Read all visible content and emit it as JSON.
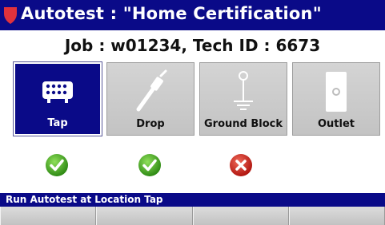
{
  "header": {
    "title": "Autotest : \"Home Certification\"",
    "job_line": "Job : w01234, Tech ID : 6673"
  },
  "locations": [
    {
      "label": "Tap",
      "icon": "tap-icon",
      "selected": true,
      "result": "pass"
    },
    {
      "label": "Drop",
      "icon": "drop-cable-icon",
      "selected": false,
      "result": "pass"
    },
    {
      "label": "Ground Block",
      "icon": "ground-block-icon",
      "selected": false,
      "result": "fail"
    },
    {
      "label": "Outlet",
      "icon": "outlet-icon",
      "selected": false,
      "result": null
    }
  ],
  "status": {
    "text": "Run Autotest at Location Tap"
  },
  "softkeys": [
    "",
    "",
    "",
    ""
  ],
  "colors": {
    "title_bg": "#0a0a88",
    "shield": "#e0323c",
    "pass": "#3a9a1e",
    "fail": "#c8231e"
  }
}
